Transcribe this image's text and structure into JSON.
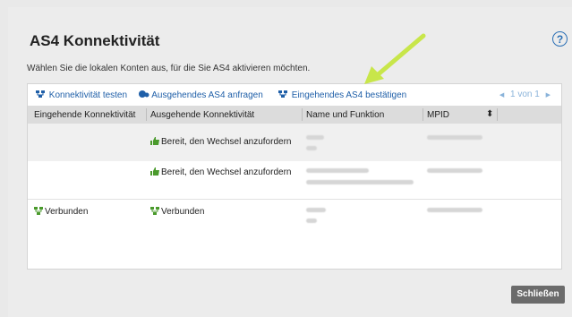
{
  "dialog": {
    "title": "AS4 Konnektivität",
    "help_label": "?",
    "subtitle": "Wählen Sie die lokalen Konten aus, für die Sie AS4 aktivieren möchten.",
    "close_label": "Schließen"
  },
  "toolbar": {
    "test_label": "Konnektivität testen",
    "outgoing_label": "Ausgehendes AS4 anfragen",
    "incoming_label": "Eingehendes AS4 bestätigen",
    "pager": "1 von 1",
    "pager_prev": "◀",
    "pager_next": "▶"
  },
  "table": {
    "columns": [
      "Eingehende Konnektivität",
      "Ausgehende Konnektivität",
      "Name und Funktion",
      "MPID"
    ],
    "sort_indicator": "⬍",
    "rows": [
      {
        "incoming": "",
        "outgoing": "Bereit, den Wechsel anzufordern"
      },
      {
        "incoming": "",
        "outgoing": "Bereit, den Wechsel anzufordern"
      },
      {
        "incoming": "Verbunden",
        "outgoing": "Verbunden"
      }
    ]
  },
  "colors": {
    "link": "#1f5fa8",
    "ready_green": "#4a9a2c",
    "close_bg": "#6b6b6b",
    "annotation_arrow": "#c8e64a"
  }
}
